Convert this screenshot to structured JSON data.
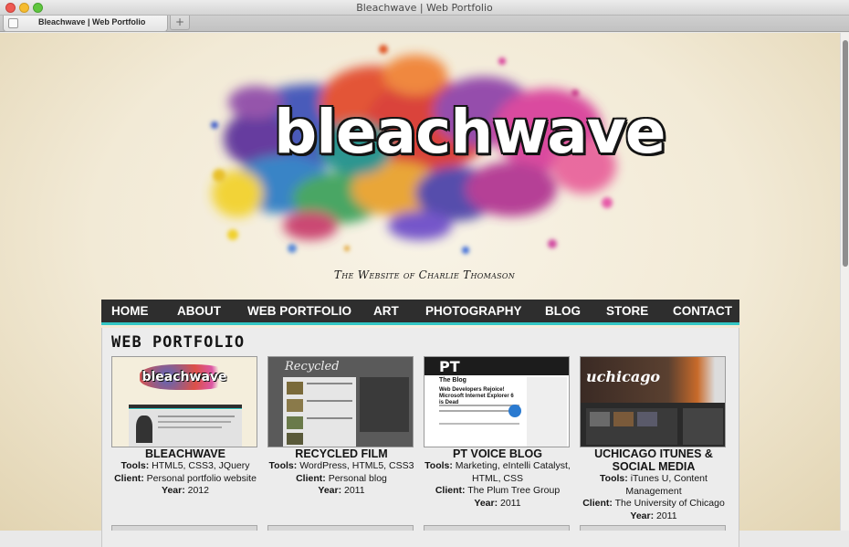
{
  "window": {
    "title": "Bleachwave | Web Portfolio"
  },
  "tabs": [
    {
      "label": "Bleachwave | Web Portfolio"
    }
  ],
  "newtab": {
    "label": "+"
  },
  "header": {
    "logo_text": "bleachwave",
    "tagline": "The Website of Charlie Thomason"
  },
  "nav": {
    "items": [
      "HOME",
      "ABOUT",
      "WEB PORTFOLIO",
      "ART",
      "PHOTOGRAPHY",
      "BLOG",
      "STORE",
      "CONTACT"
    ]
  },
  "main": {
    "section_title": "WEB PORTFOLIO",
    "tools_label": "Tools:",
    "client_label": "Client:",
    "year_label": "Year:",
    "projects": [
      {
        "title": "BLEACHWAVE",
        "tools": "HTML5, CSS3, JQuery",
        "client": "Personal portfolio website",
        "year": "2012",
        "thumb_text": "bleachwave"
      },
      {
        "title": "RECYCLED FILM",
        "tools": "WordPress, HTML5, CSS3",
        "client": "Personal blog",
        "year": "2011",
        "thumb_text": "Recycled"
      },
      {
        "title": "PT VOICE BLOG",
        "tools": "Marketing, eIntelli Catalyst, HTML, CSS",
        "client": "The Plum Tree Group",
        "year": "2011",
        "thumb_text": "PT",
        "thumb_sub": "The Blog",
        "thumb_headline": "Web Developers Rejoice! Microsoft Internet Explorer 6 is Dead"
      },
      {
        "title": "UCHICAGO ITUNES & SOCIAL MEDIA",
        "tools": "iTunes U, Content Management",
        "client": "The University of Chicago",
        "year": "2011",
        "thumb_text": "uchicago"
      }
    ]
  },
  "colors": {
    "nav_bg": "#2e2e2e",
    "nav_accent": "#33c6c4",
    "page_bg": "#f2ead6"
  }
}
